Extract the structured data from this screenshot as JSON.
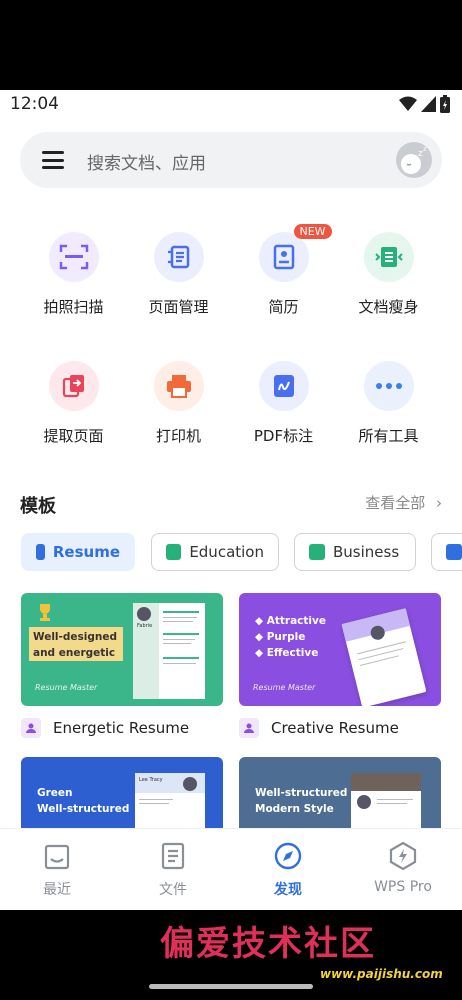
{
  "status": {
    "time": "12:04"
  },
  "search": {
    "placeholder": "搜索文档、应用"
  },
  "tools": [
    {
      "label": "拍照扫描",
      "icon": "scan-icon",
      "color": "#7c5cf0",
      "bg": "#f1ecfd"
    },
    {
      "label": "页面管理",
      "icon": "page-manage-icon",
      "color": "#4a6ef0",
      "bg": "#ebeffd"
    },
    {
      "label": "简历",
      "icon": "resume-icon",
      "color": "#4a6ef0",
      "bg": "#ebeffd",
      "badge": "NEW"
    },
    {
      "label": "文档瘦身",
      "icon": "slim-doc-icon",
      "color": "#26b07a",
      "bg": "#e5f6ee"
    },
    {
      "label": "提取页面",
      "icon": "extract-page-icon",
      "color": "#e9455a",
      "bg": "#fde9ec"
    },
    {
      "label": "打印机",
      "icon": "printer-icon",
      "color": "#f36a3a",
      "bg": "#feeee6"
    },
    {
      "label": "PDF标注",
      "icon": "pdf-annotate-icon",
      "color": "#4a6ef0",
      "bg": "#ebeffd"
    },
    {
      "label": "所有工具",
      "icon": "more-dots-icon",
      "color": "#3a7ef0",
      "bg": "#eaf1fd"
    }
  ],
  "templates": {
    "title": "模板",
    "more": "查看全部",
    "chips": [
      {
        "label": "Resume",
        "active": true,
        "color": "#2f6fde"
      },
      {
        "label": "Education",
        "active": false,
        "color": "#26b07a"
      },
      {
        "label": "Business",
        "active": false,
        "color": "#26b07a"
      },
      {
        "label": "",
        "active": false,
        "color": "#2f6fde"
      }
    ],
    "cards": [
      {
        "label": "Energetic Resume",
        "headline1": "Well-designed",
        "headline2": "and energetic",
        "brand": "Resume Master",
        "resume_name": "Fabrie"
      },
      {
        "label": "Creative Resume",
        "points": [
          "Attractive",
          "Purple",
          "Effective"
        ],
        "brand": "Resume Master"
      },
      {
        "label": "",
        "headline1": "Green",
        "headline2": "Well-structured",
        "resume_name": "Lee Tracy"
      },
      {
        "label": "",
        "headline1": "Well-structured",
        "headline2": "Modern Style"
      }
    ]
  },
  "nav": [
    {
      "label": "最近",
      "icon": "recent-icon",
      "active": false
    },
    {
      "label": "文件",
      "icon": "files-icon",
      "active": false
    },
    {
      "label": "发现",
      "icon": "discover-compass-icon",
      "active": true
    },
    {
      "label": "WPS Pro",
      "icon": "wps-pro-icon",
      "active": false
    }
  ],
  "watermark": {
    "text": "偏爱技术社区",
    "url": "www.paijishu.com"
  },
  "colors": {
    "accent": "#2f6fde",
    "green_card": "#3bb58a",
    "purple_card": "#8a4fe0",
    "blue_card": "#2d5fd0",
    "slate_card": "#4d6d92"
  }
}
